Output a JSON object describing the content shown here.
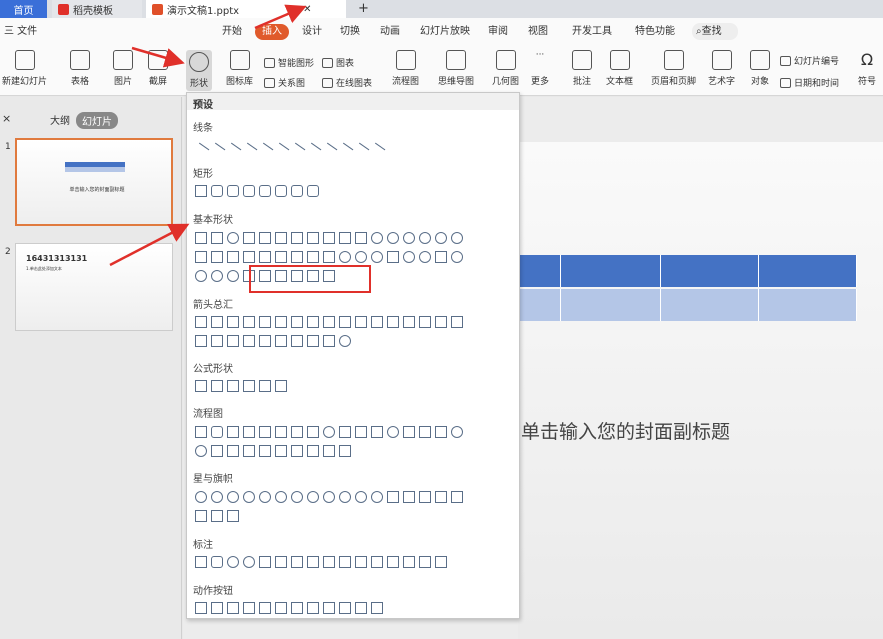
{
  "tabs": [
    {
      "label": "首页"
    },
    {
      "label": "稻壳模板"
    },
    {
      "label": "演示文稿1.pptx"
    }
  ],
  "menu": {
    "file": "三 文件",
    "items": [
      "开始",
      "插入",
      "设计",
      "切换",
      "动画",
      "幻灯片放映",
      "审阅",
      "视图",
      "开发工具",
      "特色功能"
    ],
    "search": "查找"
  },
  "ribbon": {
    "new_slide": "新建幻灯片",
    "table": "表格",
    "picture": "图片",
    "screenshot": "截屏",
    "shape": "形状",
    "icon_lib": "图标库",
    "smart": "智能图形",
    "chart": "图表",
    "relation": "关系图",
    "online_chart": "在线图表",
    "flowchart": "流程图",
    "mindmap": "思维导图",
    "geometry": "几何图",
    "more": "更多",
    "comment": "批注",
    "textbox": "文本框",
    "header_footer": "页眉和页脚",
    "wordart": "艺术字",
    "object": "对象",
    "slide_number": "幻灯片编号",
    "datetime": "日期和时间",
    "symbol": "符号"
  },
  "pane": {
    "outline": "大纲",
    "slides": "幻灯片",
    "thumb1_text": "单击输入您的封面副标题",
    "thumb2_title": "16431313131",
    "thumb2_sub": "1.单击此处添加文本",
    "num1": "1",
    "num2": "2",
    "close": "×"
  },
  "popup": {
    "header": "预设",
    "cats": [
      "线条",
      "矩形",
      "基本形状",
      "箭头总汇",
      "公式形状",
      "流程图",
      "星与旗帜",
      "标注",
      "动作按钮"
    ]
  },
  "slide": {
    "subtitle": "单击输入您的封面副标题"
  },
  "colors": {
    "accent": "#e05a2b",
    "table_head": "#4472c4",
    "table_row": "#b4c6e7",
    "home_tab": "#3a6fd8"
  }
}
